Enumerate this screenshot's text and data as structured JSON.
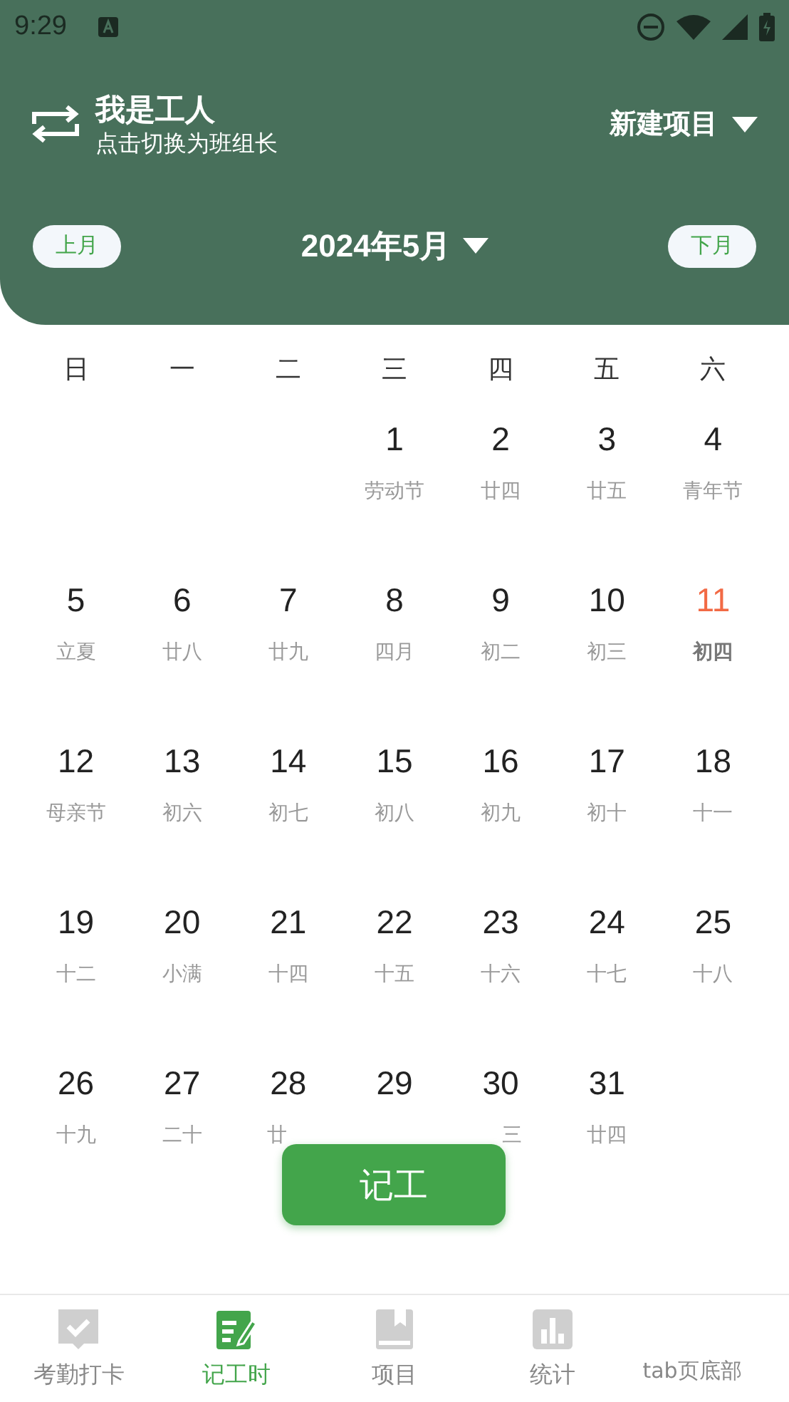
{
  "status_bar": {
    "time": "9:29"
  },
  "header": {
    "role_title": "我是工人",
    "role_subtitle": "点击切换为班组长",
    "project_menu": "新建项目",
    "prev_month": "上月",
    "month": "2024年5月",
    "next_month": "下月"
  },
  "weekdays": [
    "日",
    "一",
    "二",
    "三",
    "四",
    "五",
    "六"
  ],
  "weeks": [
    [
      {
        "kind": "blank"
      },
      {
        "kind": "blank"
      },
      {
        "kind": "blank"
      },
      {
        "kind": "day",
        "day": "1",
        "lunar": "劳动节",
        "today": false
      },
      {
        "kind": "day",
        "day": "2",
        "lunar": "廿四",
        "today": false
      },
      {
        "kind": "day",
        "day": "3",
        "lunar": "廿五",
        "today": false
      },
      {
        "kind": "day",
        "day": "4",
        "lunar": "青年节",
        "today": false
      }
    ],
    [
      {
        "kind": "day",
        "day": "5",
        "lunar": "立夏",
        "today": false
      },
      {
        "kind": "day",
        "day": "6",
        "lunar": "廿八",
        "today": false
      },
      {
        "kind": "day",
        "day": "7",
        "lunar": "廿九",
        "today": false
      },
      {
        "kind": "day",
        "day": "8",
        "lunar": "四月",
        "today": false
      },
      {
        "kind": "day",
        "day": "9",
        "lunar": "初二",
        "today": false
      },
      {
        "kind": "day",
        "day": "10",
        "lunar": "初三",
        "today": false
      },
      {
        "kind": "day",
        "day": "11",
        "lunar": "初四",
        "today": true
      }
    ],
    [
      {
        "kind": "day",
        "day": "12",
        "lunar": "母亲节",
        "today": false
      },
      {
        "kind": "day",
        "day": "13",
        "lunar": "初六",
        "today": false
      },
      {
        "kind": "day",
        "day": "14",
        "lunar": "初七",
        "today": false
      },
      {
        "kind": "day",
        "day": "15",
        "lunar": "初八",
        "today": false
      },
      {
        "kind": "day",
        "day": "16",
        "lunar": "初九",
        "today": false
      },
      {
        "kind": "day",
        "day": "17",
        "lunar": "初十",
        "today": false
      },
      {
        "kind": "day",
        "day": "18",
        "lunar": "十一",
        "today": false
      }
    ],
    [
      {
        "kind": "day",
        "day": "19",
        "lunar": "十二",
        "today": false
      },
      {
        "kind": "day",
        "day": "20",
        "lunar": "小满",
        "today": false
      },
      {
        "kind": "day",
        "day": "21",
        "lunar": "十四",
        "today": false
      },
      {
        "kind": "day",
        "day": "22",
        "lunar": "十五",
        "today": false
      },
      {
        "kind": "day",
        "day": "23",
        "lunar": "十六",
        "today": false
      },
      {
        "kind": "day",
        "day": "24",
        "lunar": "十七",
        "today": false
      },
      {
        "kind": "day",
        "day": "25",
        "lunar": "十八",
        "today": false
      }
    ],
    [
      {
        "kind": "day",
        "day": "26",
        "lunar": "十九",
        "today": false
      },
      {
        "kind": "day",
        "day": "27",
        "lunar": "二十",
        "today": false
      },
      {
        "kind": "day",
        "day": "28",
        "lunar": "廿",
        "lunar_cut_right": true,
        "today": false
      },
      {
        "kind": "day",
        "day": "29",
        "today": false
      },
      {
        "kind": "day",
        "day": "30",
        "lunar": "三",
        "lunar_cut_left": true,
        "today": false
      },
      {
        "kind": "day",
        "day": "31",
        "lunar": "廿四",
        "today": false
      },
      {
        "kind": "blank"
      }
    ]
  ],
  "record_button": "记工",
  "tabs": [
    {
      "kind": "check",
      "label": "考勤打卡",
      "selected": false
    },
    {
      "kind": "note",
      "label": "记工时",
      "selected": true
    },
    {
      "kind": "book",
      "label": "项目",
      "selected": false
    },
    {
      "kind": "chart",
      "label": "统计",
      "selected": false
    },
    {
      "kind": "text",
      "label": "tab页底部",
      "selected": false
    }
  ]
}
